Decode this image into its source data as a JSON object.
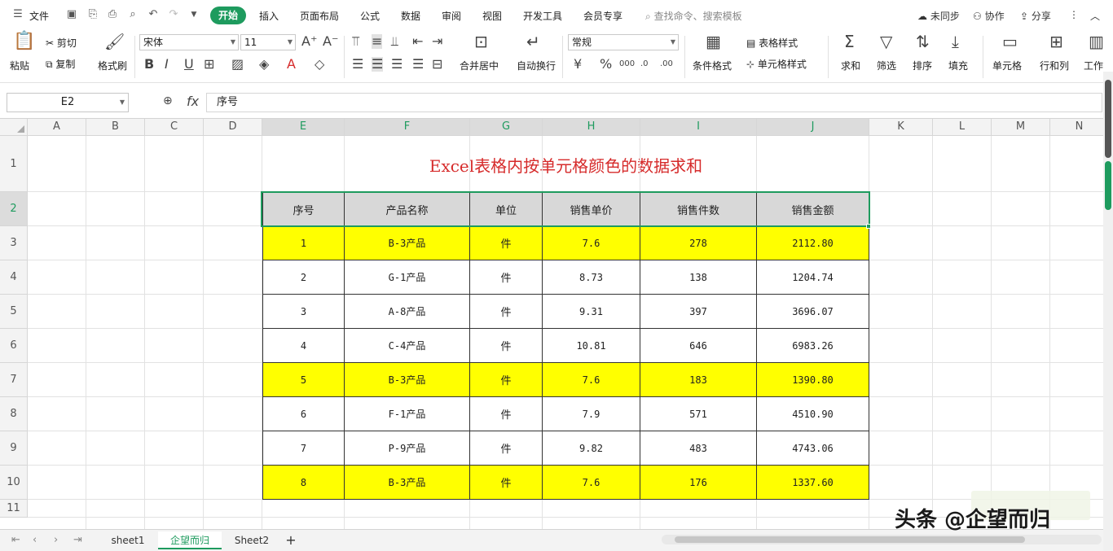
{
  "menubar": {
    "file": "文件",
    "tabs": [
      "开始",
      "插入",
      "页面布局",
      "公式",
      "数据",
      "审阅",
      "视图",
      "开发工具",
      "会员专享"
    ],
    "search_placeholder": "查找命令、搜索模板",
    "sync": "未同步",
    "collab": "协作",
    "share": "分享"
  },
  "ribbon": {
    "paste": "粘贴",
    "cut": "剪切",
    "copy": "复制",
    "format_painter": "格式刷",
    "font_name": "宋体",
    "font_size": "11",
    "merge_center": "合并居中",
    "wrap_text": "自动换行",
    "number_format": "常规",
    "conditional_format": "条件格式",
    "table_style": "表格样式",
    "cell_style": "单元格样式",
    "sum": "求和",
    "filter": "筛选",
    "sort": "排序",
    "fill": "填充",
    "cell": "单元格",
    "row_col": "行和列",
    "worksheet": "工作"
  },
  "formula_bar": {
    "name_box": "E2",
    "fx": "fx",
    "value": "序号"
  },
  "grid": {
    "columns": [
      "A",
      "B",
      "C",
      "D",
      "E",
      "F",
      "G",
      "H",
      "I",
      "J",
      "K",
      "L",
      "M",
      "N"
    ],
    "rows": [
      "1",
      "2",
      "3",
      "4",
      "5",
      "6",
      "7",
      "8",
      "9",
      "10",
      "11"
    ],
    "title": "Excel表格内按单元格颜色的数据求和",
    "headers": [
      "序号",
      "产品名称",
      "单位",
      "销售单价",
      "销售件数",
      "销售金额"
    ],
    "data": [
      [
        "1",
        "B-3产品",
        "件",
        "7.6",
        "278",
        "2112.80"
      ],
      [
        "2",
        "G-1产品",
        "件",
        "8.73",
        "138",
        "1204.74"
      ],
      [
        "3",
        "A-8产品",
        "件",
        "9.31",
        "397",
        "3696.07"
      ],
      [
        "4",
        "C-4产品",
        "件",
        "10.81",
        "646",
        "6983.26"
      ],
      [
        "5",
        "B-3产品",
        "件",
        "7.6",
        "183",
        "1390.80"
      ],
      [
        "6",
        "F-1产品",
        "件",
        "7.9",
        "571",
        "4510.90"
      ],
      [
        "7",
        "P-9产品",
        "件",
        "9.82",
        "483",
        "4743.06"
      ],
      [
        "8",
        "B-3产品",
        "件",
        "7.6",
        "176",
        "1337.60"
      ]
    ],
    "highlighted_rows": [
      0,
      4,
      7
    ],
    "highlight_color": "#ffff00",
    "title_color": "#d62b2b",
    "header_fill": "#d8d8d8"
  },
  "sheets": {
    "tabs": [
      "sheet1",
      "企望而归",
      "Sheet2"
    ],
    "active": 1,
    "add": "+"
  },
  "accent_color": "#1e9b5e",
  "watermark": "头条 @企望而归"
}
